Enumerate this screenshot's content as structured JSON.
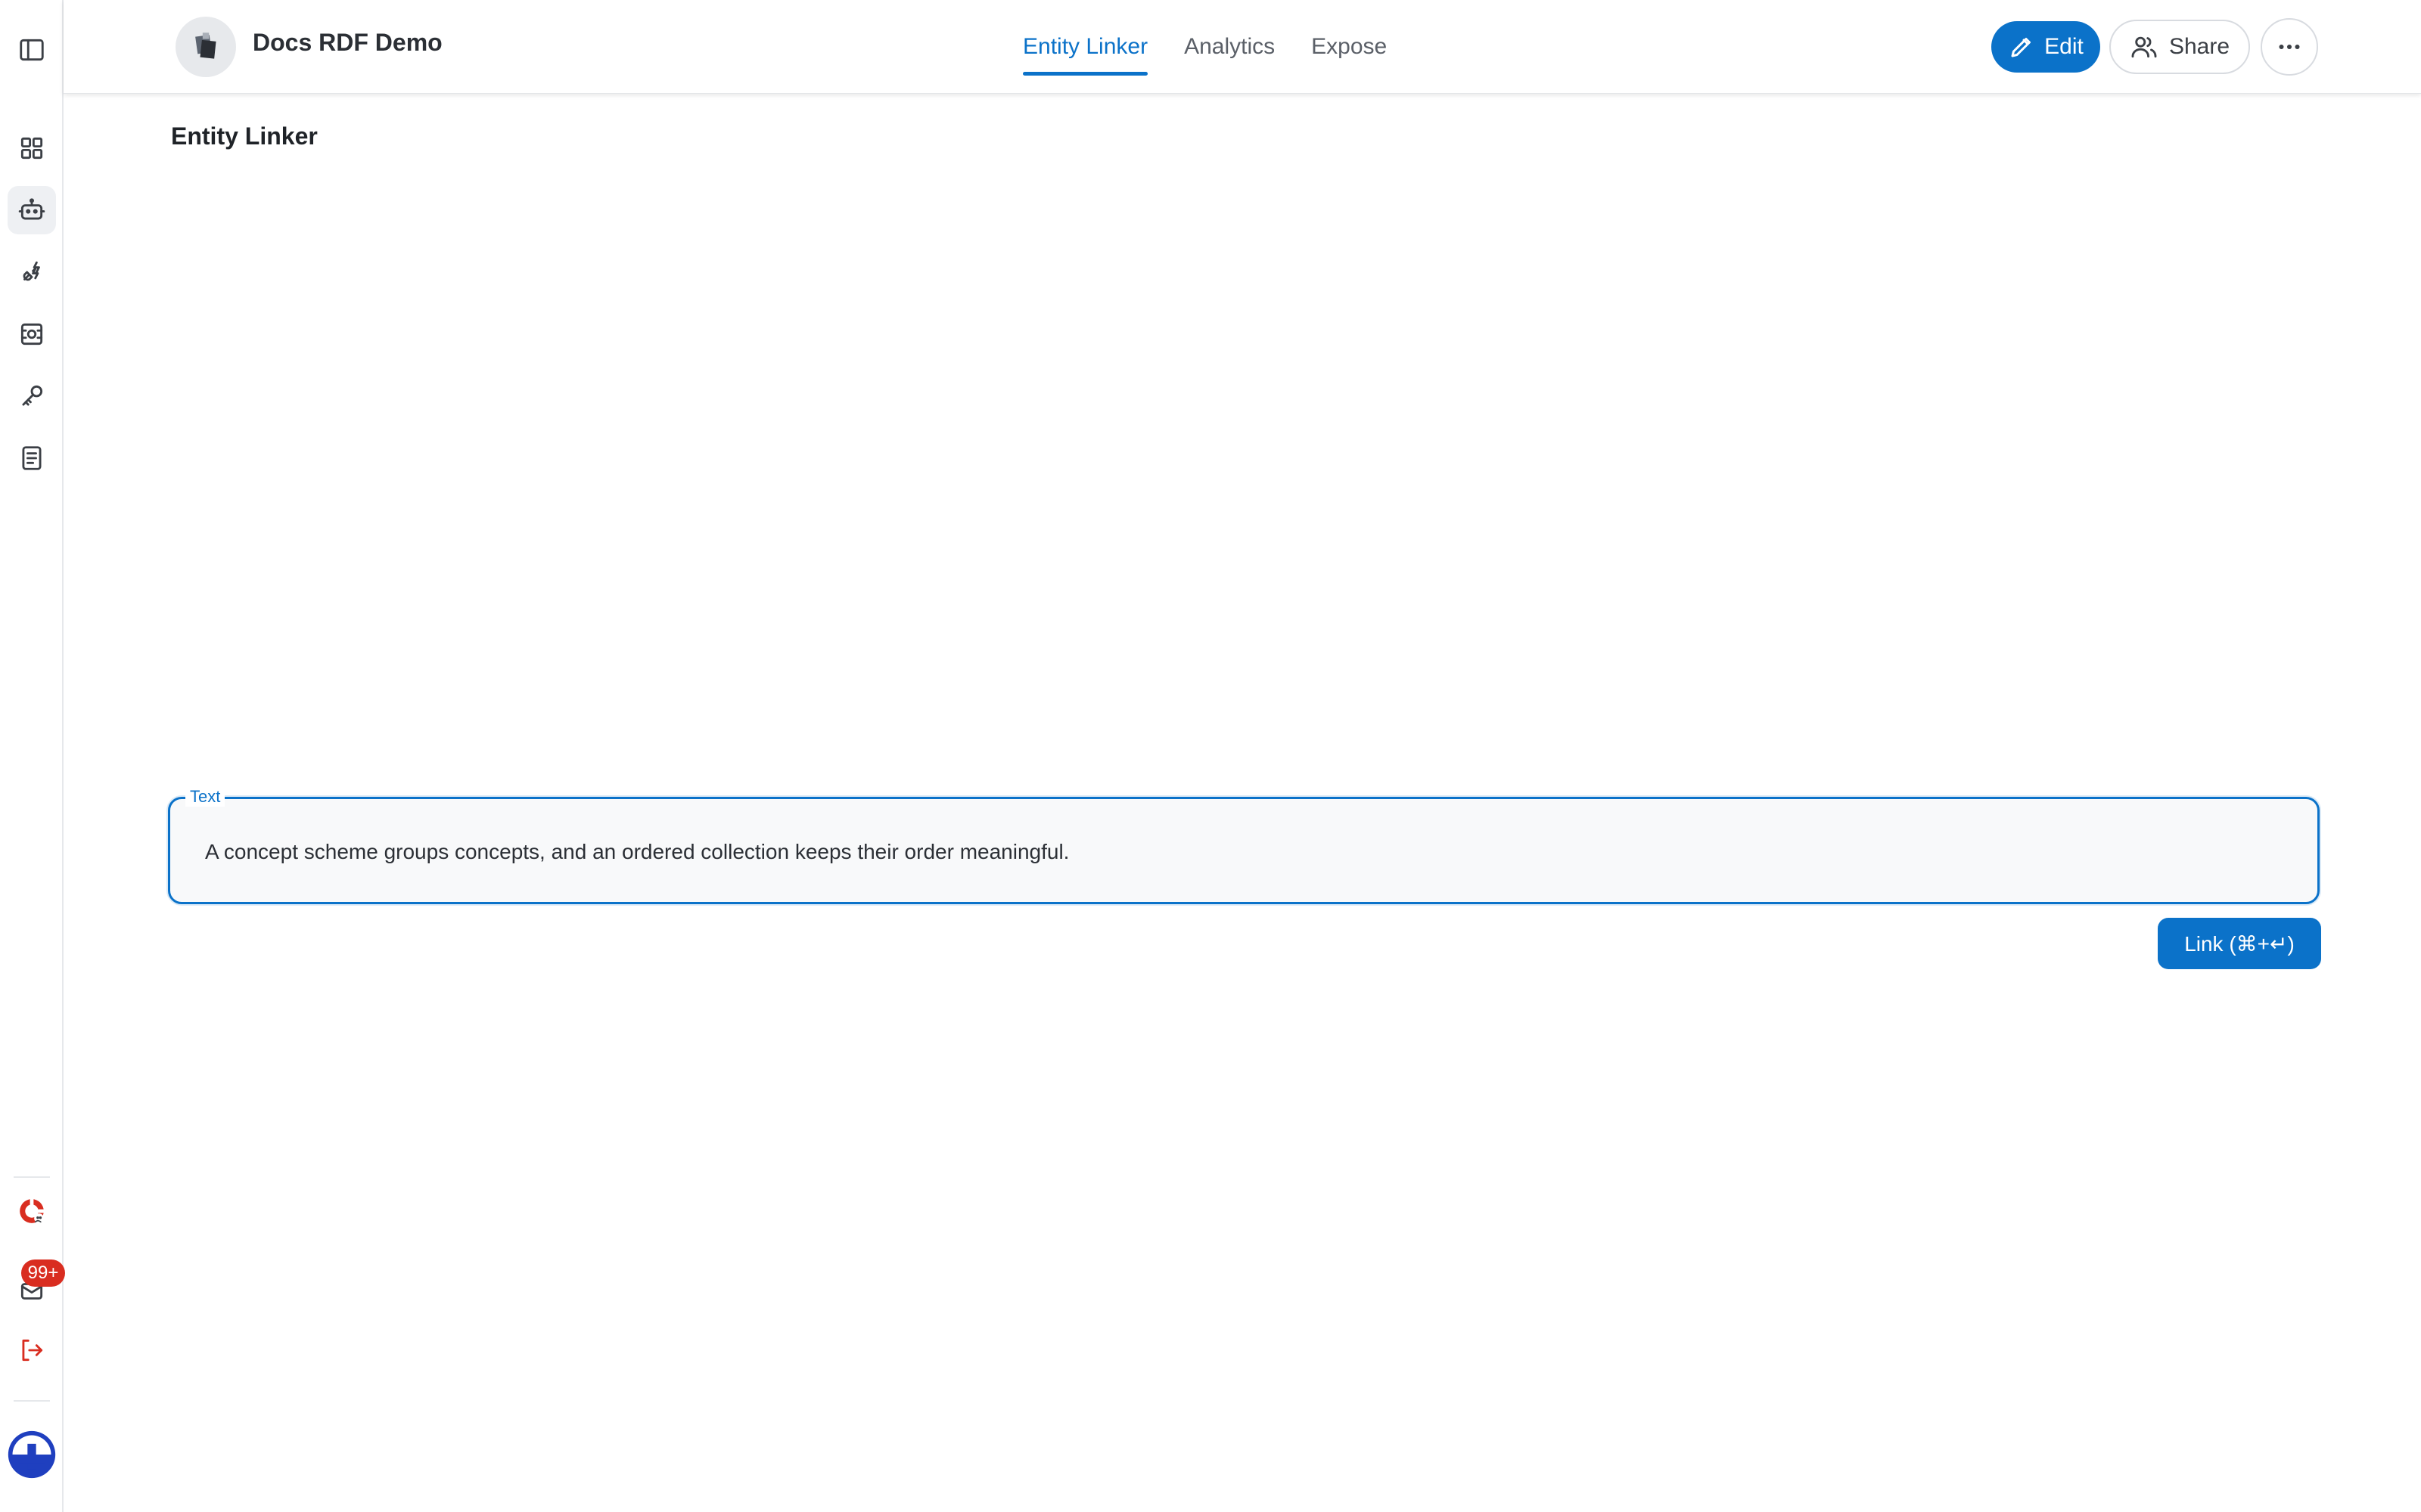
{
  "app": {
    "title": "Docs RDF Demo"
  },
  "tabs": [
    {
      "label": "Entity Linker",
      "active": true
    },
    {
      "label": "Analytics",
      "active": false
    },
    {
      "label": "Expose",
      "active": false
    }
  ],
  "actions": {
    "edit_label": "Edit",
    "share_label": "Share"
  },
  "page": {
    "heading": "Entity Linker"
  },
  "text_field": {
    "label": "Text",
    "value": "A concept scheme groups concepts, and an ordered collection keeps their order meaningful."
  },
  "link_button": {
    "label": "Link (⌘+↵)"
  },
  "sidebar": {
    "items": [
      {
        "icon": "panel-toggle-icon"
      },
      {
        "icon": "dashboard-grid-icon"
      },
      {
        "icon": "robot-icon",
        "active": true
      },
      {
        "icon": "plug-icon"
      },
      {
        "icon": "settings-box-icon"
      },
      {
        "icon": "key-icon"
      },
      {
        "icon": "document-icon"
      }
    ],
    "notifications_badge": "99+"
  },
  "colors": {
    "accent": "#0b72c9",
    "badge": "#d92d20"
  }
}
